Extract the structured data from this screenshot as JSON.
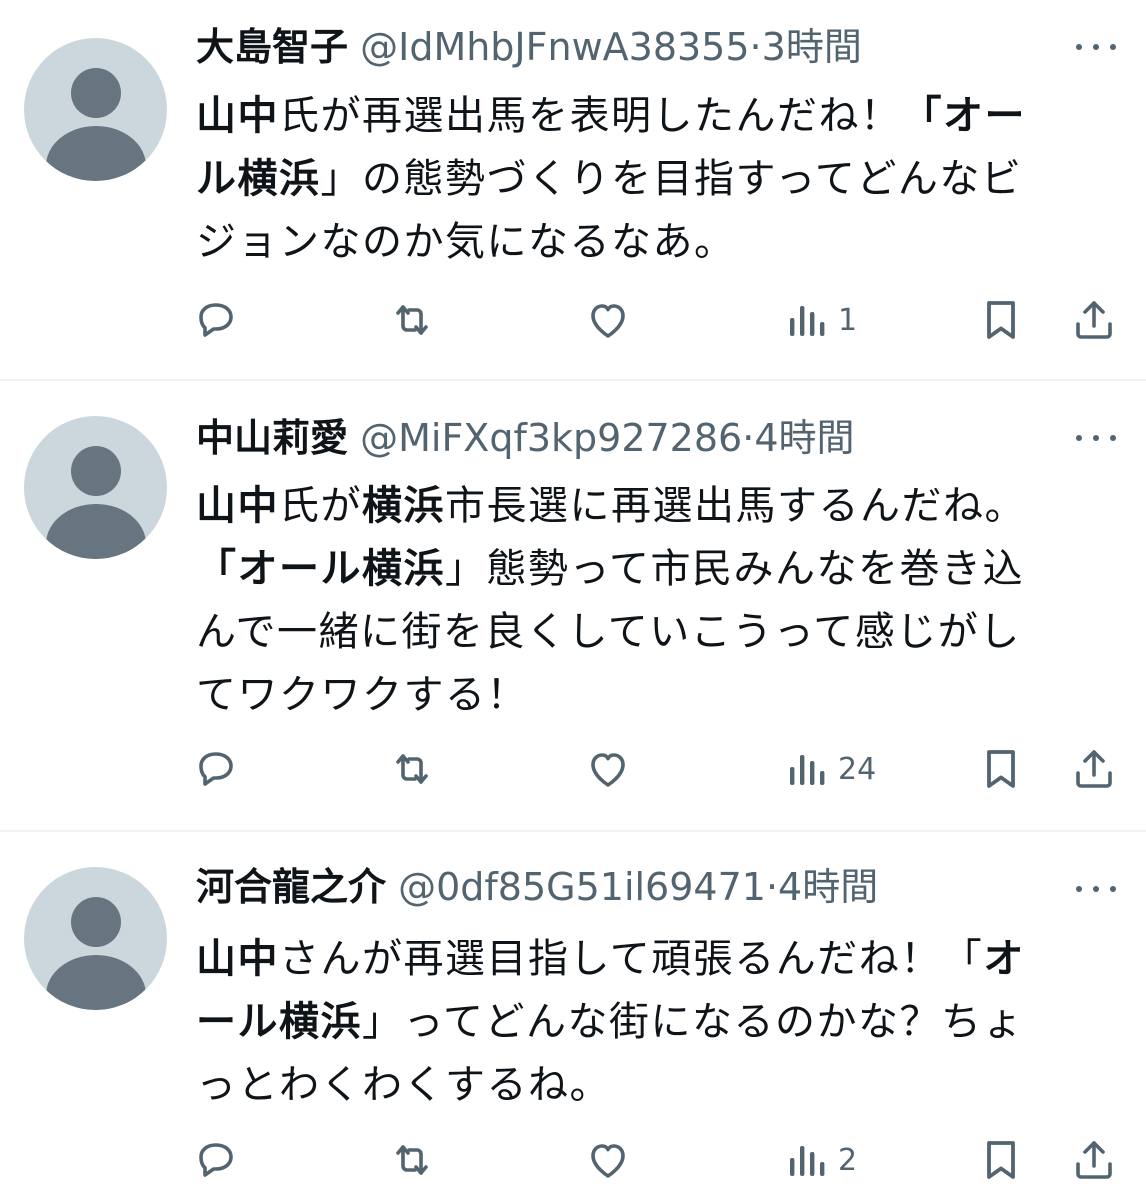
{
  "tweets": [
    {
      "display_name": "大島智子",
      "handle": "@IdMhbJFnwA38355",
      "separator": "·",
      "time": "3時間",
      "text_lines": [
        [
          {
            "t": "山中",
            "b": true
          },
          {
            "t": "氏が再選出馬を表明したんだね！",
            "b": false
          },
          {
            "t": "「オー",
            "b": true
          }
        ],
        [
          {
            "t": "ル横浜",
            "b": true
          },
          {
            "t": "」の態勢づくりを目指すってどんなビ",
            "b": false
          }
        ],
        [
          {
            "t": "ジョンなのか気になるなあ。",
            "b": false
          }
        ]
      ],
      "views": "1"
    },
    {
      "display_name": "中山莉愛",
      "handle": "@MiFXqf3kp927286",
      "separator": "·",
      "time": "4時間",
      "text_lines": [
        [
          {
            "t": "山中",
            "b": true
          },
          {
            "t": "氏が",
            "b": false
          },
          {
            "t": "横浜",
            "b": true
          },
          {
            "t": "市長選に再選出馬するんだね。",
            "b": false
          }
        ],
        [
          {
            "t": "「オール横浜",
            "b": true
          },
          {
            "t": "」態勢って市民みんなを巻き込",
            "b": false
          }
        ],
        [
          {
            "t": "んで一緒に街を良くしていこうって感じがし",
            "b": false
          }
        ],
        [
          {
            "t": "てワクワクする！",
            "b": false
          }
        ]
      ],
      "views": "24"
    },
    {
      "display_name": "河合龍之介",
      "handle": "@0df85G51il69471",
      "separator": "·",
      "time": "4時間",
      "text_lines": [
        [
          {
            "t": "山中",
            "b": true
          },
          {
            "t": "さんが再選目指して頑張るんだね！「",
            "b": false
          },
          {
            "t": "オ",
            "b": true
          }
        ],
        [
          {
            "t": "ール横浜",
            "b": true
          },
          {
            "t": "」ってどんな街になるのかな？ちょ",
            "b": false
          }
        ],
        [
          {
            "t": "っとわくわくするね。",
            "b": false
          }
        ]
      ],
      "views": "2"
    }
  ],
  "icons": {
    "reply": "reply-icon",
    "retweet": "retweet-icon",
    "like": "heart-icon",
    "views": "views-icon",
    "bookmark": "bookmark-icon",
    "share": "share-icon",
    "more": "more-icon",
    "avatar": "default-avatar-icon"
  },
  "colors": {
    "text": "#0f1419",
    "secondary": "#536471",
    "avatar_bg": "#ccd6dd",
    "divider": "#eff3f4"
  }
}
